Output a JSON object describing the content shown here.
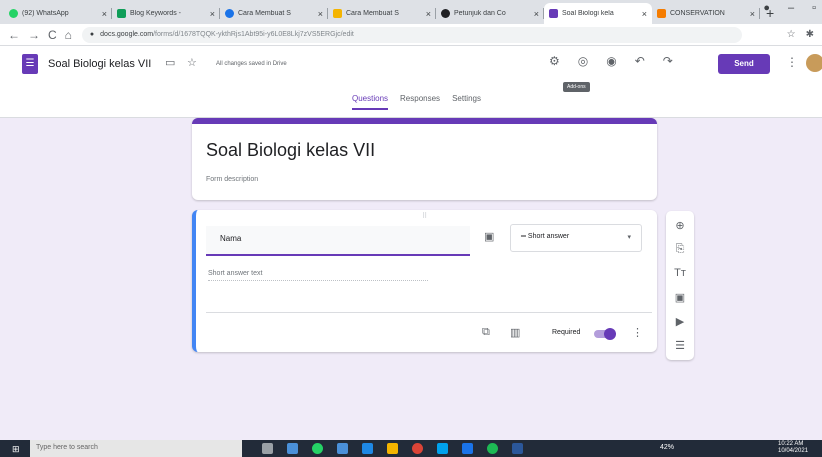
{
  "browser": {
    "tabs": [
      {
        "title": "(92) WhatsApp",
        "color": "#25d366"
      },
      {
        "title": "Blog Keywords -",
        "color": "#0f9d58"
      },
      {
        "title": "Cara Membuat S",
        "color": "#1a73e8"
      },
      {
        "title": "Cara Membuat S",
        "color": "#f4b400"
      },
      {
        "title": "Petunjuk dan Co",
        "color": "#202124"
      },
      {
        "title": "Soal Biologi kela",
        "color": "#673ab7",
        "active": true
      },
      {
        "title": "CONSERVATION",
        "color": "#f57c00"
      }
    ],
    "new_tab": "+",
    "url_host": "docs.google.com",
    "url_path": "/forms/d/1678TQQK-ykthRjs1Abt95i-y6L0E8Lkj7zVS5ERGjc/edit"
  },
  "app": {
    "title": "Soal Biologi kelas VII",
    "saved_status": "All changes saved in Drive",
    "tooltip": "Add-ons",
    "send_label": "Send",
    "tabs": [
      {
        "label": "Questions",
        "active": true
      },
      {
        "label": "Responses"
      },
      {
        "label": "Settings"
      }
    ]
  },
  "form": {
    "title": "Soal Biologi kelas VII",
    "description": "Form description"
  },
  "question": {
    "title": "Nama",
    "type": "Short answer",
    "answer_placeholder": "Short answer text",
    "required_label": "Required",
    "required": true
  },
  "taskbar": {
    "search_placeholder": "Type here to search",
    "time": "10:22 AM",
    "date": "10/04/2021",
    "battery": "42%"
  }
}
